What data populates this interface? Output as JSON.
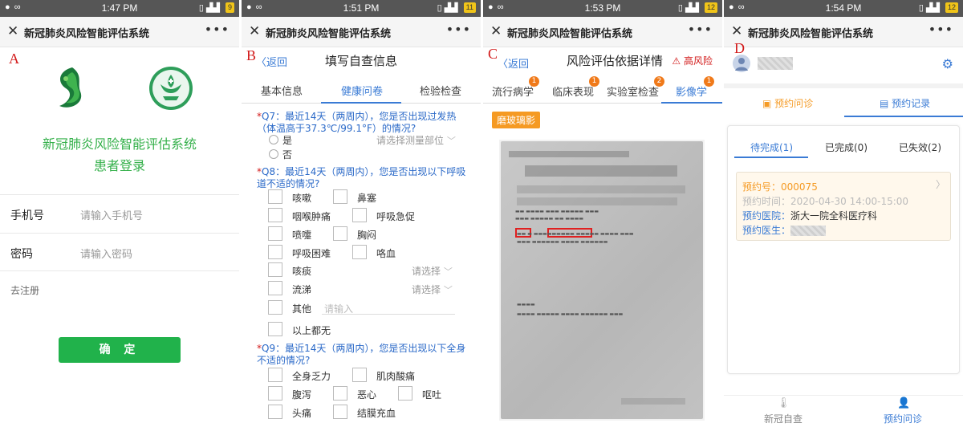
{
  "status_bars": {
    "a": {
      "time": "1:47 PM",
      "battery": "9"
    },
    "b": {
      "time": "1:51 PM",
      "battery": "11"
    },
    "c": {
      "time": "1:53 PM",
      "battery": "12"
    },
    "d": {
      "time": "1:54 PM",
      "battery": "12"
    }
  },
  "app_title": "新冠肺炎风险智能评估系统",
  "panel_labels": {
    "a": "A",
    "b": "B",
    "c": "C",
    "d": "D"
  },
  "panel_a": {
    "system_name": "新冠肺炎风险智能评估系统",
    "subtitle": "患者登录",
    "phone_label": "手机号",
    "phone_placeholder": "请输入手机号",
    "password_label": "密码",
    "password_placeholder": "请输入密码",
    "register_link": "去注册",
    "confirm_button": "确 定"
  },
  "panel_b": {
    "back": "返回",
    "title": "填写自查信息",
    "tabs": [
      "基本信息",
      "健康问卷",
      "检验检查"
    ],
    "q7": {
      "title": "Q7：最近14天（两周内），您是否出现过发热（体温高于37.3℃/99.1°F）的情况?",
      "yes": "是",
      "no": "否",
      "select": "请选择测量部位"
    },
    "q8": {
      "title": "Q8：最近14天（两周内），您是否出现以下呼吸道不适的情况?",
      "options": [
        "咳嗽",
        "鼻塞",
        "咽喉肿痛",
        "呼吸急促",
        "喷嚏",
        "胸闷",
        "呼吸困难",
        "咯血",
        "咳痰",
        "流涕",
        "其他",
        "以上都无"
      ],
      "select": "请选择",
      "other_placeholder": "请输入"
    },
    "q9": {
      "title": "Q9：最近14天（两周内），您是否出现以下全身不适的情况?",
      "options": [
        "全身乏力",
        "肌肉酸痛",
        "腹泻",
        "恶心",
        "呕吐",
        "头痛",
        "结膜充血"
      ]
    }
  },
  "panel_c": {
    "back": "返回",
    "title": "风险评估依据详情",
    "risk": "高风险",
    "tabs": [
      {
        "label": "流行病学",
        "badge": "1"
      },
      {
        "label": "临床表现",
        "badge": "1"
      },
      {
        "label": "实验室检查",
        "badge": "2"
      },
      {
        "label": "影像学",
        "badge": "1"
      }
    ],
    "tag": "磨玻璃影"
  },
  "panel_d": {
    "tabs": [
      "预约问诊",
      "预约记录"
    ],
    "subtabs": [
      "待完成(1)",
      "已完成(0)",
      "已失效(2)"
    ],
    "appointment": {
      "number_label": "预约号：",
      "number": "000075",
      "time_label": "预约时间：",
      "time": "2020-04-30 14:00-15:00",
      "hospital_label": "预约医院：",
      "hospital": "浙大一院全科医疗科",
      "doctor_label": "预约医生："
    },
    "bottom": [
      "新冠自查",
      "预约问诊"
    ]
  },
  "colors": {
    "green": "#21b24b",
    "blue": "#3a7bd5",
    "red": "#d21a1a",
    "orange": "#f59a23"
  }
}
